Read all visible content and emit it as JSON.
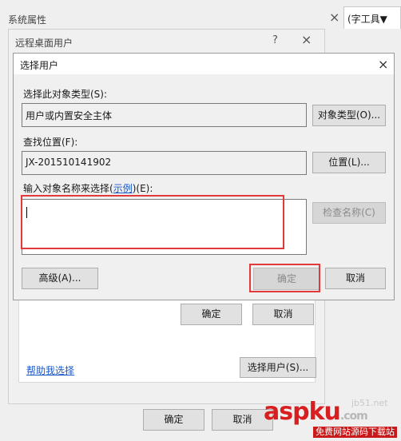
{
  "bg_window": {
    "title": "系统属性",
    "close_icon": "×",
    "tab_fragment": "(字工具▼"
  },
  "rd_window": {
    "title": "远程桌面用户",
    "help_icon": "?",
    "close_icon": "×",
    "ok": "确定",
    "cancel": "取消",
    "help_link": "帮助我选择",
    "select_users": "选择用户(S)..."
  },
  "bottom_bar": {
    "ok": "确定",
    "cancel": "取消"
  },
  "select_dialog": {
    "title": "选择用户",
    "close_icon": "×",
    "object_type_label": "选择此对象类型(S):",
    "object_type_value": "用户或内置安全主体",
    "object_type_button": "对象类型(O)...",
    "location_label": "查找位置(F):",
    "location_value": "JX-201510141902",
    "location_button": "位置(L)...",
    "names_label_prefix": "输入对象名称来选择(",
    "names_label_link": "示例",
    "names_label_suffix": ")(E):",
    "names_value": "",
    "check_names": "检查名称(C)",
    "advanced": "高级(A)...",
    "ok": "确定",
    "cancel": "取消"
  },
  "watermark": {
    "brand": "aspku",
    "tld": ".com",
    "slogan": "免费网站源码下载站",
    "corner": "jb51.net"
  },
  "colors": {
    "highlight": "#e23a3a",
    "link": "#1a58c7",
    "watermark": "#d81e1e"
  }
}
